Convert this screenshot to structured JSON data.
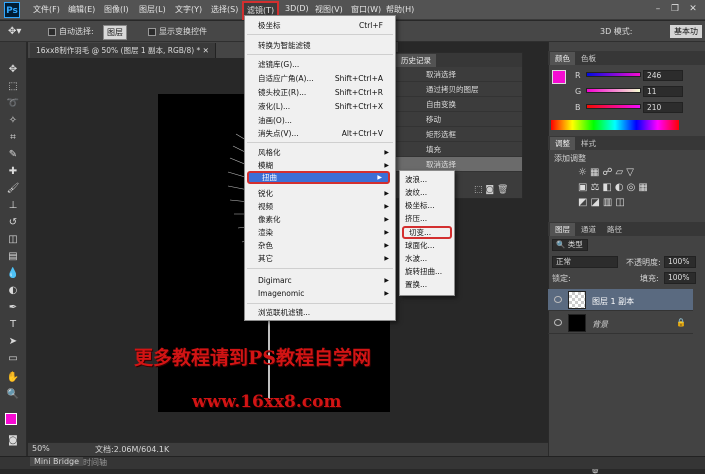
{
  "app": {
    "logo": "Ps"
  },
  "menubar": {
    "items": [
      "文件(F)",
      "编辑(E)",
      "图像(I)",
      "图层(L)",
      "文字(Y)",
      "选择(S)",
      "滤镜(T)",
      "3D(D)",
      "视图(V)",
      "窗口(W)",
      "帮助(H)"
    ],
    "active": "滤镜(T)"
  },
  "options": {
    "auto_select": "自动选择:",
    "auto_select_value": "图层",
    "show_transform": "显示变换控件",
    "mode_3d": "3D 模式:",
    "workspace": "基本功"
  },
  "document": {
    "tab_label": "16xx8制作羽毛 @ 50% (图层 1 副本, RGB/8) *"
  },
  "filter_menu": {
    "items": [
      {
        "label": "极坐标",
        "shortcut": "Ctrl+F"
      },
      {
        "label": "转换为智能滤镜"
      },
      {
        "label": "滤镜库(G)..."
      },
      {
        "label": "自适应广角(A)...",
        "shortcut": "Shift+Ctrl+A"
      },
      {
        "label": "镜头校正(R)...",
        "shortcut": "Shift+Ctrl+R"
      },
      {
        "label": "液化(L)...",
        "shortcut": "Shift+Ctrl+X"
      },
      {
        "label": "油画(O)..."
      },
      {
        "label": "消失点(V)...",
        "shortcut": "Alt+Ctrl+V"
      },
      {
        "label": "风格化"
      },
      {
        "label": "模糊"
      },
      {
        "label": "扭曲"
      },
      {
        "label": "锐化"
      },
      {
        "label": "视频"
      },
      {
        "label": "像素化"
      },
      {
        "label": "渲染"
      },
      {
        "label": "杂色"
      },
      {
        "label": "其它"
      },
      {
        "label": "Digimarc"
      },
      {
        "label": "Imagenomic"
      },
      {
        "label": "浏览联机滤镜..."
      }
    ]
  },
  "distort_submenu": {
    "items": [
      "波浪...",
      "波纹...",
      "极坐标...",
      "挤压...",
      "切变...",
      "球面化...",
      "水波...",
      "旋转扭曲...",
      "置换..."
    ],
    "highlighted": "切变..."
  },
  "history": {
    "title": "历史记录",
    "items": [
      "取消选择",
      "通过拷贝的图层",
      "自由变换",
      "移动",
      "矩形选框",
      "填充",
      "取消选择"
    ]
  },
  "color_panel": {
    "tabs": [
      "颜色",
      "色板"
    ],
    "r_label": "R",
    "g_label": "G",
    "b_label": "B",
    "r": "246",
    "g": "11",
    "b": "210",
    "swatch": "#f60bd2"
  },
  "adjust_panel": {
    "tabs": [
      "调整",
      "样式"
    ],
    "add_label": "添加调整"
  },
  "layers_panel": {
    "tabs": [
      "图层",
      "通道",
      "路径"
    ],
    "kind": "类型",
    "blend": "正常",
    "opacity_label": "不透明度:",
    "opacity": "100%",
    "lock_label": "锁定:",
    "fill_label": "填充:",
    "fill": "100%",
    "layers": [
      {
        "name": "图层 1 副本"
      },
      {
        "name": "背景"
      }
    ]
  },
  "status": {
    "zoom": "50%",
    "doc": "文档:2.06M/604.1K"
  },
  "bottom": {
    "tabs": [
      "Mini Bridge",
      "时间轴"
    ]
  },
  "watermark": {
    "line1": "更多教程请到PS教程自学网",
    "line2": "www.16xx8.com"
  }
}
